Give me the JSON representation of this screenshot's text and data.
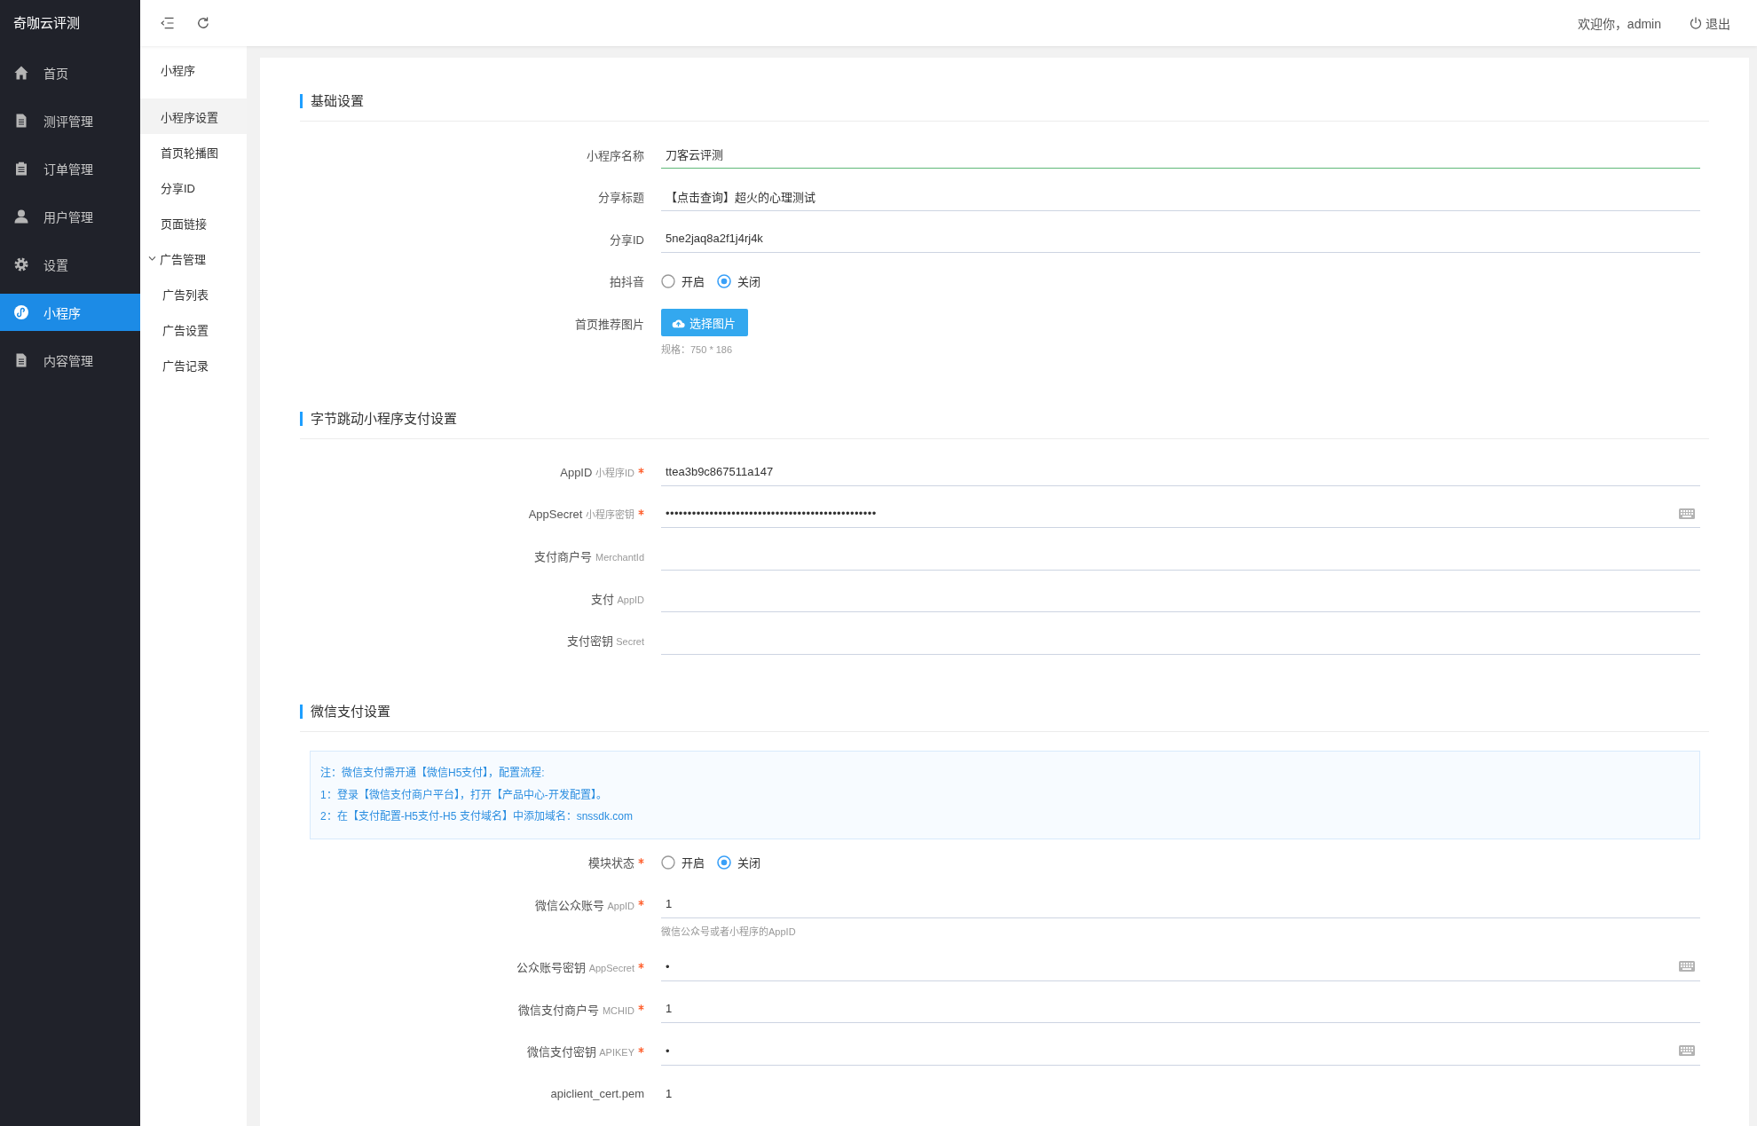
{
  "sidebar": {
    "logo": "奇咖云评测",
    "items": [
      {
        "label": "首页",
        "selected": false
      },
      {
        "label": "测评管理",
        "selected": false
      },
      {
        "label": "订单管理",
        "selected": false
      },
      {
        "label": "用户管理",
        "selected": false
      },
      {
        "label": "设置",
        "selected": false
      },
      {
        "label": "小程序",
        "selected": true
      },
      {
        "label": "内容管理",
        "selected": false
      }
    ]
  },
  "topbar": {
    "welcome": "欢迎你，admin",
    "logout": "退出"
  },
  "submenu": {
    "title": "小程序",
    "items": [
      {
        "label": "小程序设置",
        "selected": true
      },
      {
        "label": "首页轮播图",
        "selected": false
      },
      {
        "label": "分享ID",
        "selected": false
      },
      {
        "label": "页面链接",
        "selected": false
      },
      {
        "label": "广告管理",
        "selected": false,
        "expanded": true,
        "children": [
          {
            "label": "广告列表",
            "selected": false
          },
          {
            "label": "广告设置",
            "selected": false
          },
          {
            "label": "广告记录",
            "selected": false
          }
        ]
      }
    ]
  },
  "sections": [
    {
      "title": "基础设置",
      "fields": [
        {
          "kind": "text",
          "label": "小程序名称",
          "required": false,
          "value": "刀客云评测",
          "focused": true
        },
        {
          "kind": "text",
          "label": "分享标题",
          "required": false,
          "value": "【点击查询】超火的心理测试",
          "focused": false
        },
        {
          "kind": "text",
          "label": "分享ID",
          "required": false,
          "value": "5ne2jaq8a2f1j4rj4k",
          "focused": false
        },
        {
          "kind": "radio",
          "label": "拍抖音",
          "required": false,
          "options": [
            {
              "label": "开启",
              "selected": false
            },
            {
              "label": "关闭",
              "selected": true
            }
          ]
        },
        {
          "kind": "upload",
          "label": "首页推荐图片",
          "required": false,
          "button": "选择图片",
          "hint": "规格：750 * 186"
        }
      ]
    },
    {
      "title": "字节跳动小程序支付设置",
      "fields": [
        {
          "kind": "text",
          "label": "AppID",
          "sub": "小程序ID",
          "required": true,
          "value": "ttea3b9c867511a147",
          "focused": false
        },
        {
          "kind": "password",
          "label": "AppSecret",
          "sub": "小程序密钥",
          "required": true,
          "value": "••••••••••••••••••••••••••••••••••••••••••••••••",
          "focused": false
        },
        {
          "kind": "text",
          "label": "支付商户号",
          "sub": "MerchantId",
          "required": false,
          "focused": false
        },
        {
          "kind": "text",
          "label": "支付",
          "sub": "AppID",
          "required": false,
          "focused": false
        },
        {
          "kind": "text",
          "label": "支付密钥",
          "sub": "Secret",
          "required": false,
          "focused": false
        }
      ]
    },
    {
      "title": "微信支付设置",
      "notice": [
        "注：微信支付需开通【微信H5支付】，配置流程:",
        "1：登录【微信支付商户平台】，打开【产品中心-开发配置】。",
        "2：在【支付配置-H5支付-H5 支付域名】中添加域名：snssdk.com"
      ],
      "fields": [
        {
          "kind": "radio",
          "label": "模块状态",
          "required": true,
          "options": [
            {
              "label": "开启",
              "selected": false
            },
            {
              "label": "关闭",
              "selected": true
            }
          ]
        },
        {
          "kind": "text",
          "label": "微信公众账号",
          "sub": "AppID",
          "required": true,
          "value": "1",
          "focused": false,
          "hint": "微信公众号或者小程序的AppID"
        },
        {
          "kind": "password",
          "label": "公众账号密钥",
          "sub": "AppSecret",
          "required": true,
          "value": "•",
          "focused": false
        },
        {
          "kind": "text",
          "label": "微信支付商户号",
          "sub": "MCHID",
          "required": true,
          "value": "1",
          "focused": false
        },
        {
          "kind": "password",
          "label": "微信支付密钥",
          "sub": "APIKEY",
          "required": true,
          "value": "•",
          "focused": false
        },
        {
          "kind": "textarea",
          "label": "apiclient_cert.pem",
          "required": false,
          "value": "1"
        }
      ]
    }
  ]
}
